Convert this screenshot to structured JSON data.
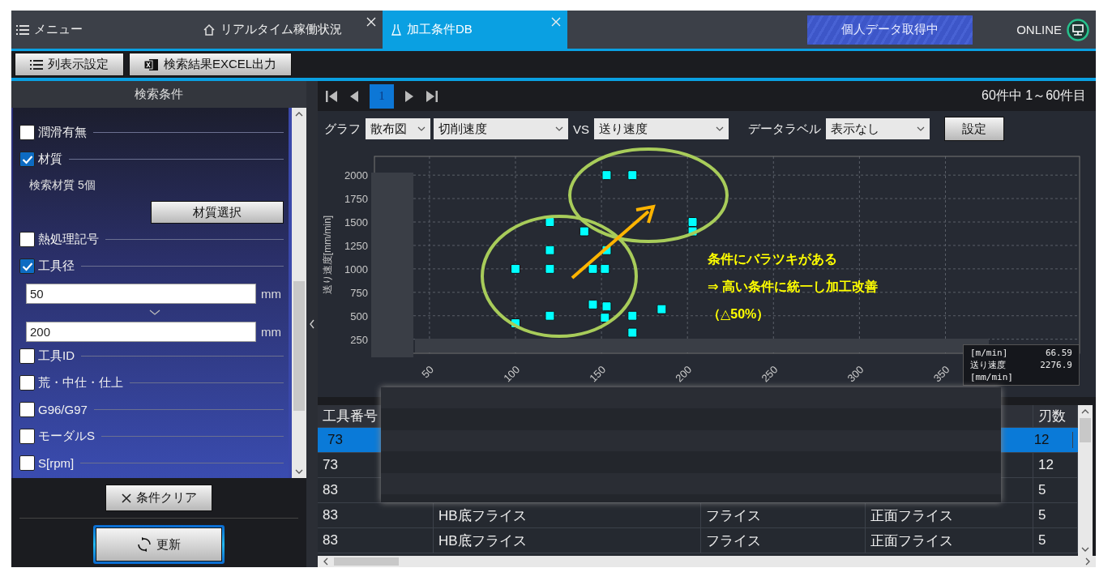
{
  "top_bar": {
    "menu_label": "メニュー",
    "tabs": [
      {
        "label": "リアルタイム稼働状況",
        "selected": false
      },
      {
        "label": "加工条件DB",
        "selected": true
      }
    ],
    "status_badge": "個人データ取得中",
    "connection": "ONLINE"
  },
  "toolbar": {
    "buttons": [
      "列表示設定",
      "検索結果EXCEL出力"
    ]
  },
  "search_panel": {
    "title": "検索条件",
    "criteria": [
      {
        "kind": "check",
        "label": "潤滑有無",
        "checked": false
      },
      {
        "kind": "check",
        "label": "材質",
        "checked": true
      },
      {
        "kind": "info",
        "text": "検索材質 5個"
      },
      {
        "kind": "button",
        "label": "材質選択"
      },
      {
        "kind": "check",
        "label": "熱処理記号",
        "checked": false
      },
      {
        "kind": "check",
        "label": "工具径",
        "checked": true
      },
      {
        "kind": "range",
        "from": "50",
        "from_unit": "mm",
        "to": "200",
        "to_unit": "mm"
      },
      {
        "kind": "check",
        "label": "工具ID",
        "checked": false
      },
      {
        "kind": "check",
        "label": "荒・中仕・仕上",
        "checked": false
      },
      {
        "kind": "check",
        "label": "G96/G97",
        "checked": false
      },
      {
        "kind": "check",
        "label": "モーダルS",
        "checked": false
      },
      {
        "kind": "check",
        "label": "S[rpm]",
        "checked": false
      }
    ],
    "clear_button": "条件クリア",
    "refresh_button": "更新"
  },
  "pager": {
    "pages": [
      {
        "label": "1",
        "selected": true
      }
    ],
    "summary": "60件中 1～60件目"
  },
  "chart_controls": {
    "graph_label": "グラフ",
    "graph_type": "散布図",
    "x_field": "切削速度",
    "vs_label": "VS",
    "y_field": "送り速度",
    "data_label_label": "データラベル",
    "data_label_value": "表示なし",
    "apply_button": "設定"
  },
  "chart": {
    "chart_data": {
      "type": "scatter",
      "ylabel": "送り速度[mm/min]",
      "xlim": [
        18,
        428
      ],
      "ylim": [
        100,
        2200
      ],
      "xticks": [
        50,
        100,
        150,
        200,
        250,
        300,
        350
      ],
      "yticks": [
        250,
        500,
        750,
        1000,
        1250,
        1500,
        1750,
        2000
      ],
      "x": [
        153,
        168,
        120,
        140,
        120,
        153,
        100,
        120,
        145,
        152,
        145,
        153,
        120,
        152,
        168,
        168,
        100,
        185,
        203,
        203
      ],
      "grid": true,
      "series": [
        {
          "color": "#00ffff",
          "values": [
            2000,
            2000,
            1500,
            1400,
            1200,
            1200,
            1000,
            1000,
            1000,
            1000,
            620,
            600,
            500,
            480,
            500,
            320,
            420,
            570,
            1500,
            1400
          ]
        }
      ]
    },
    "annotations": [
      "条件にバラツキがある",
      "⇒ 高い条件に統一し加工改善",
      "（△50%）"
    ],
    "tooltip": [
      {
        "label": "[m/min]",
        "value": "66.59"
      },
      {
        "label": "送り速度[mm/min]",
        "value": "2276.9"
      }
    ]
  },
  "table": {
    "columns": [
      "工具番号",
      null,
      null,
      null,
      "刃数"
    ],
    "rows": [
      {
        "selected": true,
        "cells": [
          "73",
          null,
          null,
          null,
          "12"
        ]
      },
      {
        "selected": false,
        "cells": [
          "73",
          null,
          null,
          null,
          "12"
        ]
      },
      {
        "selected": false,
        "cells": [
          "83",
          null,
          null,
          null,
          "5"
        ]
      },
      {
        "selected": false,
        "cells": [
          "83",
          "HB底フライス",
          "フライス",
          "正面フライス",
          "5"
        ]
      },
      {
        "selected": false,
        "cells": [
          "83",
          "HB底フライス",
          "フライス",
          "正面フライス",
          "5"
        ]
      }
    ]
  }
}
